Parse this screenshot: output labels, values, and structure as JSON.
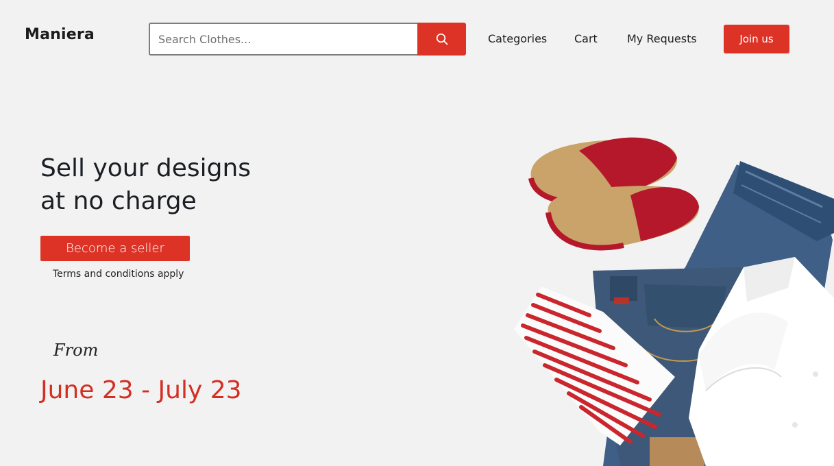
{
  "header": {
    "logo": "Maniera",
    "search": {
      "placeholder": "Search Clothes...",
      "value": "",
      "icon": "search-icon"
    },
    "nav": {
      "categories": "Categories",
      "cart": "Cart",
      "requests": "My Requests",
      "join": "Join us"
    }
  },
  "hero": {
    "title_line1": "Sell your designs",
    "title_line2": "at no charge",
    "cta": "Become a seller",
    "terms": "Terms and conditions apply",
    "from": "From",
    "dates": "June 23 - July 23"
  },
  "colors": {
    "accent": "#dd3326",
    "dates": "#d42e22",
    "background": "#f2f2f2",
    "text": "#1b1f24"
  }
}
